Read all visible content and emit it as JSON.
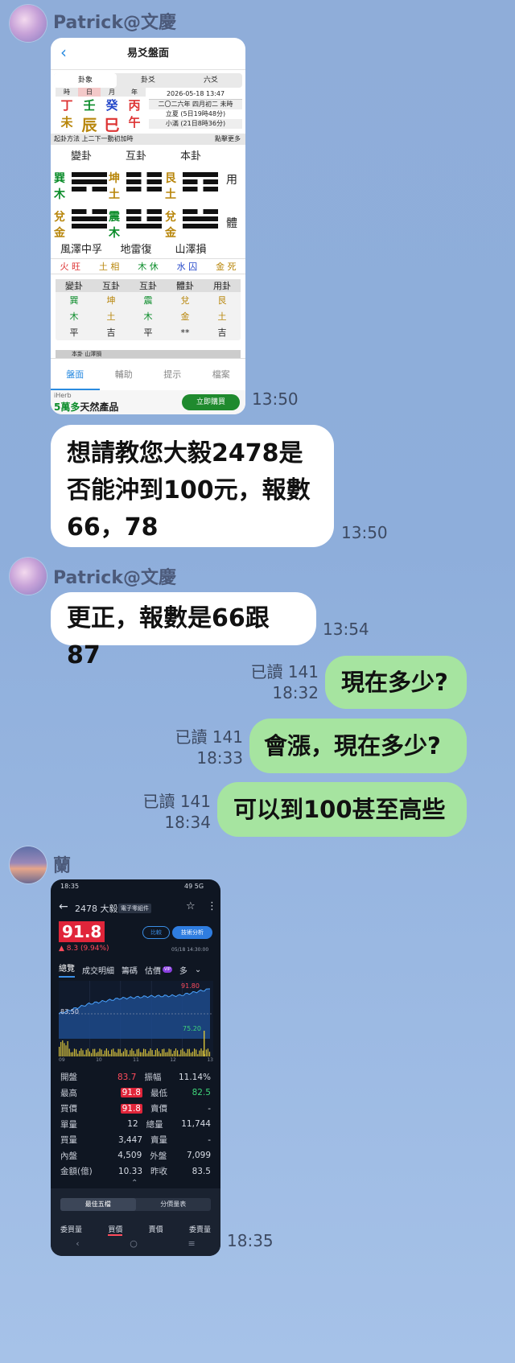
{
  "messages": {
    "m1": {
      "sender": "Patrick@文慶",
      "time": "13:50"
    },
    "m2": {
      "lines": [
        "想請教您大毅2478是",
        "否能沖到100元，報數",
        "66，78"
      ],
      "time": "13:50"
    },
    "m3": {
      "sender": "Patrick@文慶",
      "text": "更正，報數是66跟87",
      "time": "13:54"
    },
    "m4": {
      "read": "已讀 141",
      "time": "18:32",
      "text": "現在多少?"
    },
    "m5": {
      "read": "已讀 141",
      "time": "18:33",
      "text": "會漲，現在多少?"
    },
    "m6": {
      "read": "已讀 141",
      "time": "18:34",
      "text": "可以到100甚至高些"
    },
    "m7": {
      "sender": "蘭",
      "time": "18:35"
    }
  },
  "shot1": {
    "title": "易爻盤面",
    "tabs": [
      "卦象",
      "卦爻",
      "六爻"
    ],
    "pillar_heads": [
      "時",
      "日",
      "月",
      "年"
    ],
    "stems": [
      "丁",
      "壬",
      "癸",
      "丙"
    ],
    "branches": [
      "未",
      "辰",
      "巳",
      "午"
    ],
    "date": "2026-05-18 13:47",
    "lunar": "二〇二六年 四月初二 未時",
    "solar1": "立夏 (5日19時48分)",
    "solar2": "小滿 (21日8時36分)",
    "method_bar": "起卦方法 上二下一動初加時",
    "more": "點擊更多",
    "hex_titles": [
      "變卦",
      "互卦",
      "本卦"
    ],
    "side_labels": [
      "用",
      "體"
    ],
    "hex1_elems": [
      "巽",
      "木",
      "兌",
      "金"
    ],
    "hex2_elems": [
      "坤",
      "土",
      "震",
      "木"
    ],
    "hex3_elems": [
      "艮",
      "土",
      "兌",
      "金"
    ],
    "hex_names": [
      "風澤中孚",
      "地雷復",
      "山澤損"
    ],
    "seasons": [
      "火 旺",
      "土 相",
      "木 休",
      "水 囚",
      "金 死"
    ],
    "table_head": [
      "變卦",
      "互卦",
      "互卦",
      "體卦",
      "用卦"
    ],
    "table_r1": [
      "巽",
      "坤",
      "震",
      "兌",
      "艮"
    ],
    "table_r2": [
      "木",
      "土",
      "木",
      "金",
      "土"
    ],
    "table_r3": [
      "平",
      "吉",
      "平",
      "**",
      "吉"
    ],
    "bottom_strip": "本卦 山澤損",
    "nav": [
      "盤面",
      "輔助",
      "提示",
      "檔案"
    ],
    "ad_brand": "iHerb",
    "ad_text_a": "5萬多",
    "ad_text_b": "天然產品",
    "ad_button": "立即購買"
  },
  "shot2": {
    "status_time": "18:35",
    "status_right": "49 5G",
    "title": "2478 大毅",
    "tag": "電子零組件",
    "price": "91.8",
    "change": "▲ 8.3 (9.94%)",
    "date": "05/18 14:30:00",
    "btn1": "比較",
    "btn2": "技術分析",
    "tabs": [
      "總覽",
      "成交明細",
      "籌碼",
      "估價",
      "VIP",
      "多"
    ],
    "chart_high": "91.80",
    "chart_ref": "83.50",
    "chart_vol": "75.20",
    "time_axis": [
      "09",
      "10",
      "11",
      "12",
      "13"
    ],
    "rows": [
      {
        "k": "開盤",
        "v": "83.7",
        "k2": "振幅",
        "v2": "11.14%"
      },
      {
        "k": "最高",
        "v": "91.8",
        "k2": "最低",
        "v2": "82.5"
      },
      {
        "k": "買價",
        "v": "91.8",
        "k2": "賣價",
        "v2": "-"
      },
      {
        "k": "單量",
        "v": "12",
        "k2": "總量",
        "v2": "11,744"
      },
      {
        "k": "買量",
        "v": "3,447",
        "k2": "賣量",
        "v2": "-"
      },
      {
        "k": "內盤",
        "v": "4,509",
        "k2": "外盤",
        "v2": "7,099"
      },
      {
        "k": "金額(億)",
        "v": "10.33",
        "k2": "昨收",
        "v2": "83.5"
      }
    ],
    "seg": [
      "最佳五檔",
      "分價量表"
    ],
    "bottom_labels": [
      "委買量",
      "買價",
      "賣價",
      "委賣量"
    ],
    "chart_data": {
      "type": "area",
      "x": [
        "09",
        "10",
        "11",
        "12",
        "13"
      ],
      "values": [
        83.5,
        86.8,
        88.6,
        89.3,
        89.6,
        91.8
      ],
      "ylim": [
        75.2,
        91.8
      ]
    }
  }
}
